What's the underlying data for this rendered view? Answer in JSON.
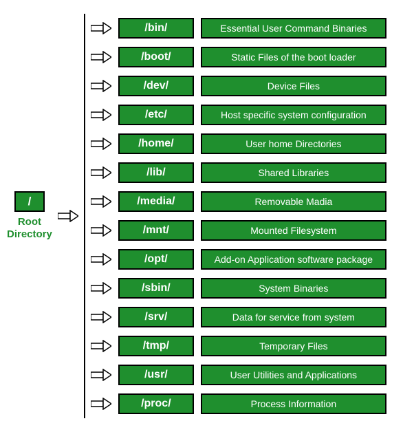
{
  "root": {
    "symbol": "/",
    "label_line1": "Root",
    "label_line2": "Directory"
  },
  "entries": [
    {
      "dir": "/bin/",
      "desc": "Essential User Command Binaries"
    },
    {
      "dir": "/boot/",
      "desc": "Static Files of the boot loader"
    },
    {
      "dir": "/dev/",
      "desc": "Device Files"
    },
    {
      "dir": "/etc/",
      "desc": "Host specific system configuration"
    },
    {
      "dir": "/home/",
      "desc": "User home Directories"
    },
    {
      "dir": "/lib/",
      "desc": "Shared Libraries"
    },
    {
      "dir": "/media/",
      "desc": "Removable Madia"
    },
    {
      "dir": "/mnt/",
      "desc": "Mounted Filesystem"
    },
    {
      "dir": "/opt/",
      "desc": "Add-on Application software package"
    },
    {
      "dir": "/sbin/",
      "desc": "System Binaries"
    },
    {
      "dir": "/srv/",
      "desc": "Data for service from system"
    },
    {
      "dir": "/tmp/",
      "desc": "Temporary Files"
    },
    {
      "dir": "/usr/",
      "desc": "User Utilities and Applications"
    },
    {
      "dir": "/proc/",
      "desc": "Process Information"
    }
  ],
  "colors": {
    "green": "#1f8f2e"
  }
}
